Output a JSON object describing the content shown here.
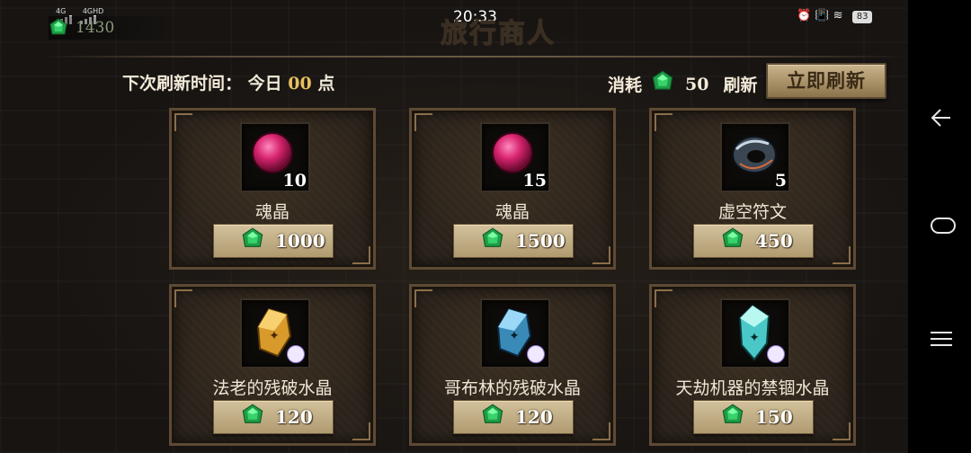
{
  "status_bar": {
    "net1": "4G",
    "net2": "4GHD",
    "time": "20:33",
    "battery": "83"
  },
  "currency": {
    "gems": "1430",
    "icon": "emerald-gem-icon"
  },
  "title": "旅行商人",
  "refresh": {
    "label": "下次刷新时间：",
    "today": "今日",
    "hour": "00",
    "unit": "点",
    "cost_label": "消耗",
    "cost_amount": "50",
    "cost_suffix": "刷新",
    "button": "立即刷新"
  },
  "shop": {
    "items": [
      {
        "name": "魂晶",
        "qty": "10",
        "price": "1000",
        "icon": "soul-crystal-icon"
      },
      {
        "name": "魂晶",
        "qty": "15",
        "price": "1500",
        "icon": "soul-crystal-icon"
      },
      {
        "name": "虚空符文",
        "qty": "5",
        "price": "450",
        "icon": "void-rune-icon"
      },
      {
        "name": "法老的残破水晶",
        "qty": "",
        "price": "120",
        "icon": "amber-crystal-icon"
      },
      {
        "name": "哥布林的残破水晶",
        "qty": "",
        "price": "120",
        "icon": "blue-crystal-icon"
      },
      {
        "name": "天劫机器的禁锢水晶",
        "qty": "",
        "price": "150",
        "icon": "cyan-crystal-icon"
      }
    ]
  },
  "colors": {
    "accent": "#e07a20",
    "gem": "#2fbf5a",
    "highlight": "#e8c060"
  }
}
